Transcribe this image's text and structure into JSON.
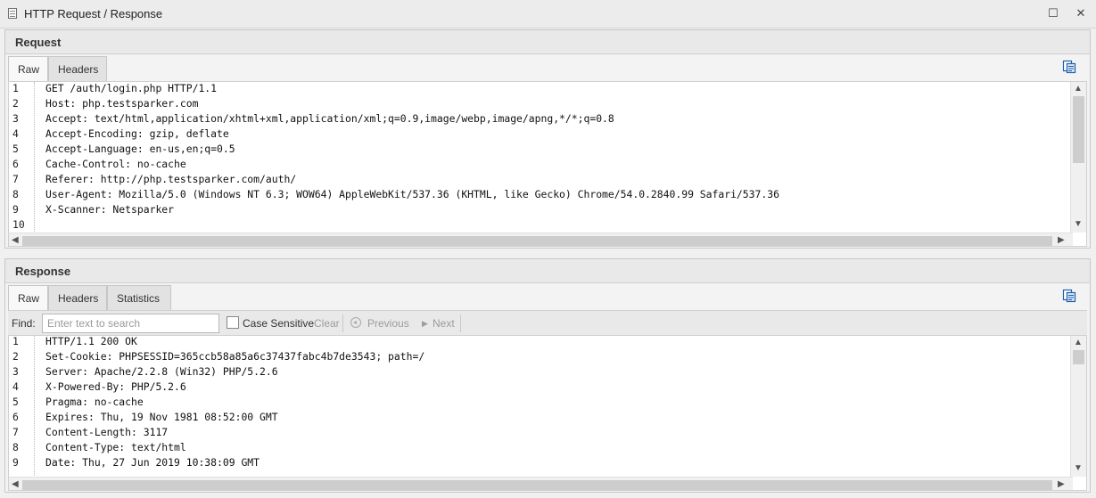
{
  "window": {
    "title": "HTTP Request / Response",
    "maximize_glyph": "☐",
    "close_glyph": "✕"
  },
  "request": {
    "heading": "Request",
    "tabs": [
      "Raw",
      "Headers"
    ],
    "lines": [
      "GET /auth/login.php HTTP/1.1",
      "Host: php.testsparker.com",
      "Accept: text/html,application/xhtml+xml,application/xml;q=0.9,image/webp,image/apng,*/*;q=0.8",
      "Accept-Encoding: gzip, deflate",
      "Accept-Language: en-us,en;q=0.5",
      "Cache-Control: no-cache",
      "Referer: http://php.testsparker.com/auth/",
      "User-Agent: Mozilla/5.0 (Windows NT 6.3; WOW64) AppleWebKit/537.36 (KHTML, like Gecko) Chrome/54.0.2840.99 Safari/537.36",
      "X-Scanner: Netsparker",
      ""
    ]
  },
  "response": {
    "heading": "Response",
    "tabs": [
      "Raw",
      "Headers",
      "Statistics"
    ],
    "find": {
      "label": "Find:",
      "placeholder": "Enter text to search",
      "case_sensitive_label": "Case Sensitive",
      "clear_label": "Clear",
      "previous_label": "Previous",
      "next_label": "Next"
    },
    "lines": [
      "HTTP/1.1 200 OK",
      "Set-Cookie: PHPSESSID=365ccb58a85a6c37437fabc4b7de3543; path=/",
      "Server: Apache/2.2.8 (Win32) PHP/5.2.6",
      "X-Powered-By: PHP/5.2.6",
      "Pragma: no-cache",
      "Expires: Thu, 19 Nov 1981 08:52:00 GMT",
      "Content-Length: 3117",
      "Content-Type: text/html",
      "Date: Thu, 27 Jun 2019 10:38:09 GMT"
    ]
  },
  "icons": {
    "copy": "copy-to-clipboard-icon",
    "scroll_up": "▲",
    "scroll_down": "▼",
    "scroll_left": "◀",
    "scroll_right": "▶",
    "next_arrow": "▶"
  },
  "colors": {
    "accent": "#1e5fa8"
  }
}
